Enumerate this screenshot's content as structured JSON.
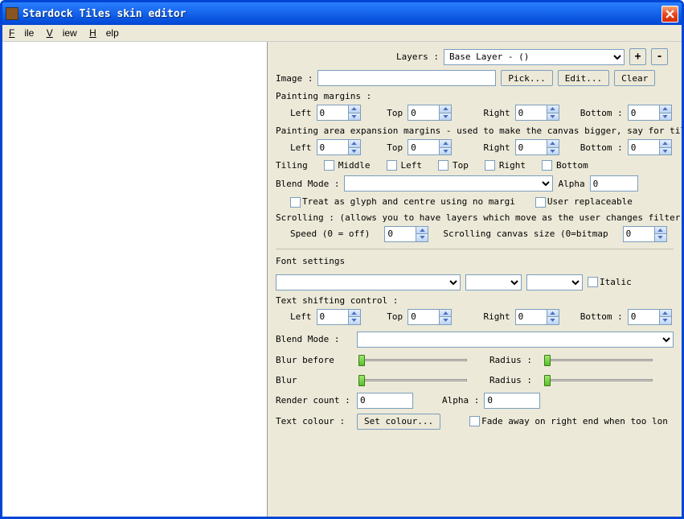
{
  "titlebar": {
    "title": "Stardock Tiles skin editor"
  },
  "menu": {
    "file": "File",
    "view": "View",
    "help": "Help"
  },
  "layers": {
    "label": "Layers :",
    "selected": "Base Layer - ()",
    "add": "+",
    "remove": "-"
  },
  "image": {
    "label": "Image :",
    "value": "",
    "pick": "Pick...",
    "edit": "Edit...",
    "clear": "Clear"
  },
  "painting_margins": {
    "label": "Painting margins :",
    "left": "Left",
    "top": "Top",
    "right": "Right",
    "bottom": "Bottom :",
    "v_left": "0",
    "v_top": "0",
    "v_right": "0",
    "v_bottom": "0"
  },
  "expansion": {
    "label": "Painting area expansion margins - used to make the canvas bigger, say for tile surrounds :",
    "v_left": "0",
    "v_top": "0",
    "v_right": "0",
    "v_bottom": "0"
  },
  "tiling": {
    "label": "Tiling",
    "middle": "Middle",
    "left": "Left",
    "top": "Top",
    "right": "Right",
    "bottom": "Bottom"
  },
  "blend1": {
    "label": "Blend Mode :",
    "alpha_label": "Alpha",
    "alpha": "0",
    "glyph": "Treat as glyph and centre using no margi",
    "user_replace": "User replaceable"
  },
  "scrolling": {
    "label": "Scrolling :  (allows you to have layers which move as the user changes filter)",
    "speed_label": "Speed (0 = off)",
    "speed": "0",
    "canvas_label": "Scrolling canvas size (0=bitmap",
    "canvas": "0"
  },
  "font": {
    "label": "Font settings",
    "italic": "Italic"
  },
  "textshift": {
    "label": "Text shifting control :",
    "v_left": "0",
    "v_top": "0",
    "v_right": "0",
    "v_bottom": "0"
  },
  "blend2": {
    "label": "Blend Mode :"
  },
  "blur": {
    "before_label": "Blur before",
    "blur_label": "Blur",
    "radius_label": "Radius :"
  },
  "render": {
    "count_label": "Render count :",
    "count": "0",
    "alpha_label": "Alpha :",
    "alpha": "0"
  },
  "textcolour": {
    "label": "Text colour :",
    "button": "Set colour...",
    "fade": "Fade away on right end when too lon"
  }
}
